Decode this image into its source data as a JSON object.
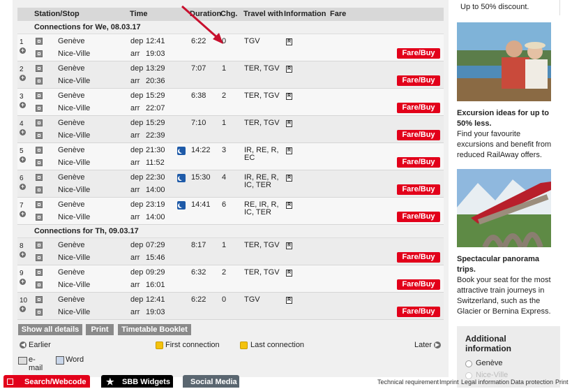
{
  "table": {
    "headers": {
      "station": "Station/Stop",
      "time": "Time",
      "duration": "Duration",
      "chg": "Chg.",
      "travel": "Travel with",
      "info": "Information",
      "fare": "Fare"
    },
    "day1": "Connections for We, 08.03.17",
    "day2": "Connections for Th, 09.03.17",
    "dep": "dep",
    "arr": "arr",
    "fare_label": "Fare/Buy",
    "info_icon": "R",
    "rows": [
      {
        "n": "1",
        "from": "Genève",
        "to": "Nice-Ville",
        "dep": "12:41",
        "arr": "19:03",
        "dur": "6:22",
        "chg": "0",
        "travel": "TGV",
        "night": false
      },
      {
        "n": "2",
        "from": "Genève",
        "to": "Nice-Ville",
        "dep": "13:29",
        "arr": "20:36",
        "dur": "7:07",
        "chg": "1",
        "travel": "TER, TGV",
        "night": false
      },
      {
        "n": "3",
        "from": "Genève",
        "to": "Nice-Ville",
        "dep": "15:29",
        "arr": "22:07",
        "dur": "6:38",
        "chg": "2",
        "travel": "TER, TGV",
        "night": false
      },
      {
        "n": "4",
        "from": "Genève",
        "to": "Nice-Ville",
        "dep": "15:29",
        "arr": "22:39",
        "dur": "7:10",
        "chg": "1",
        "travel": "TER, TGV",
        "night": false
      },
      {
        "n": "5",
        "from": "Genève",
        "to": "Nice-Ville",
        "dep": "21:30",
        "arr": "11:52",
        "dur": "14:22",
        "chg": "3",
        "travel": "IR, RE, R,",
        "travel2": "EC",
        "night": true
      },
      {
        "n": "6",
        "from": "Genève",
        "to": "Nice-Ville",
        "dep": "22:30",
        "arr": "14:00",
        "dur": "15:30",
        "chg": "4",
        "travel": "IR, RE, R,",
        "travel2": "IC, TER",
        "night": true
      },
      {
        "n": "7",
        "from": "Genève",
        "to": "Nice-Ville",
        "dep": "23:19",
        "arr": "14:00",
        "dur": "14:41",
        "chg": "6",
        "travel": "RE, IR, R,",
        "travel2": "IC, TER",
        "night": true
      },
      {
        "n": "8",
        "from": "Genève",
        "to": "Nice-Ville",
        "dep": "07:29",
        "arr": "15:46",
        "dur": "8:17",
        "chg": "1",
        "travel": "TER, TGV",
        "night": false
      },
      {
        "n": "9",
        "from": "Genève",
        "to": "Nice-Ville",
        "dep": "09:29",
        "arr": "16:01",
        "dur": "6:32",
        "chg": "2",
        "travel": "TER, TGV",
        "night": false
      },
      {
        "n": "10",
        "from": "Genève",
        "to": "Nice-Ville",
        "dep": "12:41",
        "arr": "19:03",
        "dur": "6:22",
        "chg": "0",
        "travel": "TGV",
        "night": false
      }
    ]
  },
  "buttons": {
    "show_all": "Show all details",
    "print": "Print",
    "booklet": "Timetable Booklet"
  },
  "nav": {
    "earlier": "Earlier",
    "first": "First connection",
    "last": "Last connection",
    "later": "Later"
  },
  "footer": {
    "email": "e-mail",
    "word": "Word"
  },
  "bottom": {
    "search": "Search/Webcode",
    "widgets": "SBB Widgets",
    "social": "Social Media",
    "legal": [
      "Technical requirement",
      "Imprint",
      "Legal information",
      "Data protection",
      "Print"
    ]
  },
  "sidebar": {
    "top_text": "Up to 50% discount.",
    "promo1": {
      "title1": "Excursion ideas for up to",
      "title2": "50% less.",
      "l1": "Find your favourite",
      "l2": "excursions and benefit from",
      "l3": "reduced RailAway offers."
    },
    "promo2": {
      "title1": "Spectacular panorama",
      "title2": "trips.",
      "l1": "Book your seat for the most",
      "l2": "attractive train journeys in",
      "l3": "Switzerland, such as the",
      "l4": "Glacier or Bernina Express."
    },
    "add_info1": "Additional",
    "add_info2": "information",
    "radio1": "Genève",
    "radio2": "Nice-Ville"
  },
  "colors": {
    "accent": "#e2001a",
    "header_bg": "#d8d8d8",
    "button_grey": "#8a8a8a"
  }
}
